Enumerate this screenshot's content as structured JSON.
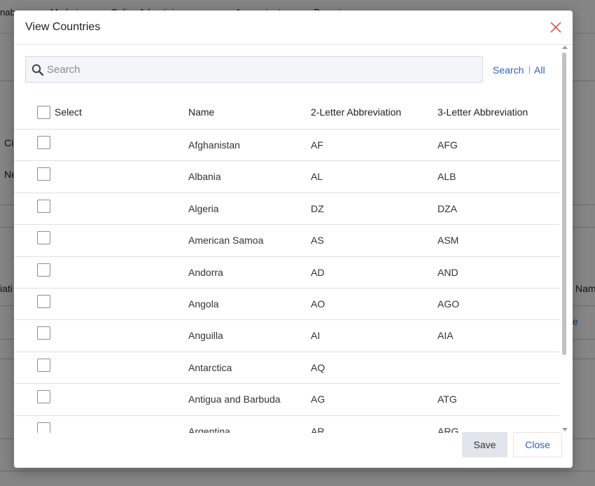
{
  "background": {
    "nav": [
      "nab",
      "Marketers",
      "Online Advertising",
      "Accountants",
      "Reports"
    ],
    "text_ci": "Ci",
    "text_ne": "Ne",
    "text_iati": "iati",
    "text_nam": "Nam",
    "link_e": "e"
  },
  "modal": {
    "title": "View Countries",
    "search": {
      "placeholder": "Search",
      "value": ""
    },
    "search_link": "Search",
    "separator": "|",
    "all_link": "All",
    "columns": [
      "Select",
      "Name",
      "2-Letter Abbreviation",
      "3-Letter Abbreviation"
    ],
    "rows": [
      {
        "name": "Afghanistan",
        "abbr2": "AF",
        "abbr3": "AFG"
      },
      {
        "name": "Albania",
        "abbr2": "AL",
        "abbr3": "ALB"
      },
      {
        "name": "Algeria",
        "abbr2": "DZ",
        "abbr3": "DZA"
      },
      {
        "name": "American Samoa",
        "abbr2": "AS",
        "abbr3": "ASM"
      },
      {
        "name": "Andorra",
        "abbr2": "AD",
        "abbr3": "AND"
      },
      {
        "name": "Angola",
        "abbr2": "AO",
        "abbr3": "AGO"
      },
      {
        "name": "Anguilla",
        "abbr2": "AI",
        "abbr3": "AIA"
      },
      {
        "name": "Antarctica",
        "abbr2": "AQ",
        "abbr3": ""
      },
      {
        "name": "Antigua and Barbuda",
        "abbr2": "AG",
        "abbr3": "ATG"
      },
      {
        "name": "Argentina",
        "abbr2": "AR",
        "abbr3": "ARG"
      }
    ],
    "save_label": "Save",
    "close_label": "Close"
  },
  "colors": {
    "accent": "#2a62c9",
    "close_icon": "#e05555",
    "search_bg": "#f3f5f8",
    "save_bg": "#e1e5ec"
  },
  "icons": {
    "close": "close-icon",
    "search": "search-icon"
  }
}
